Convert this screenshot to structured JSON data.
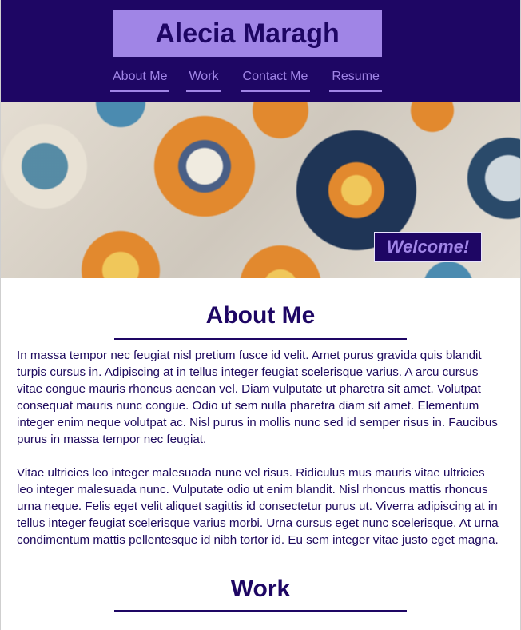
{
  "site": {
    "title": "Alecia Maragh",
    "nav": [
      "About Me",
      "Work",
      "Contact Me",
      "Resume"
    ],
    "welcome": "Welcome!"
  },
  "about": {
    "heading": "About Me",
    "paragraphs": [
      "In massa tempor nec feugiat nisl pretium fusce id velit. Amet purus gravida quis blandit turpis cursus in. Adipiscing at in tellus integer feugiat scelerisque varius. A arcu cursus vitae congue mauris rhoncus aenean vel. Diam vulputate ut pharetra sit amet. Volutpat consequat mauris nunc congue. Odio ut sem nulla pharetra diam sit amet. Elementum integer enim neque volutpat ac. Nisl purus in mollis nunc sed id semper risus in. Faucibus purus in massa tempor nec feugiat.",
      "Vitae ultricies leo integer malesuada nunc vel risus. Ridiculus mus mauris vitae ultricies leo integer malesuada nunc. Vulputate odio ut enim blandit. Nisl rhoncus mattis rhoncus urna neque. Felis eget velit aliquet sagittis id consectetur purus ut. Viverra adipiscing at in tellus integer feugiat scelerisque varius morbi. Urna cursus eget nunc scelerisque. At urna condimentum mattis pellentesque id nibh tortor id. Eu sem integer vitae justo eget magna."
    ]
  },
  "work": {
    "heading": "Work"
  },
  "colors": {
    "header_bg": "#1e0664",
    "accent": "#a085e6",
    "text": "#1e0a5e"
  }
}
